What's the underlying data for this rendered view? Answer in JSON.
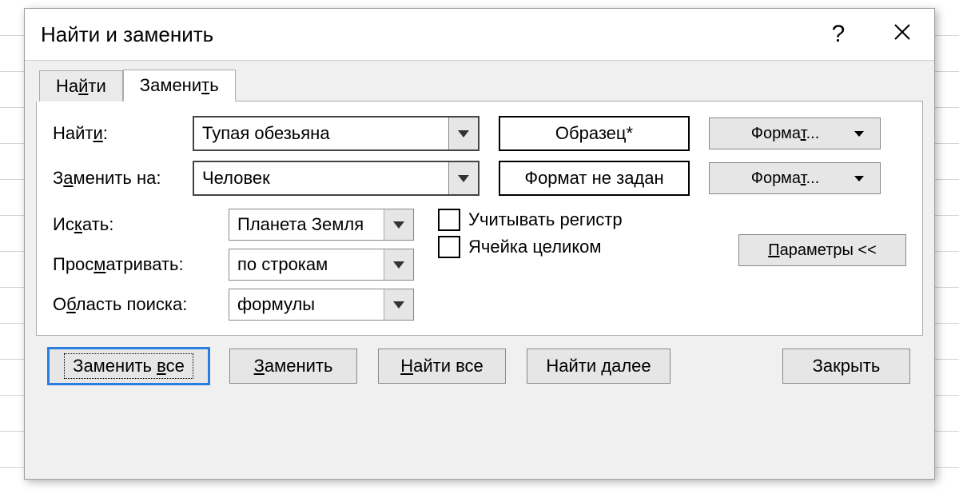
{
  "title": "Найти и заменить",
  "help_symbol": "?",
  "tabs": {
    "find": "Найти",
    "replace": "Заменить"
  },
  "labels": {
    "find_what": "Найти:",
    "replace_with": "Заменить на:",
    "search_in": "Искать:",
    "look_by": "Просматривать:",
    "look_in": "Область поиска:",
    "match_case": "Учитывать регистр",
    "whole_cell": "Ячейка целиком"
  },
  "values": {
    "find_what": "Тупая обезьяна",
    "replace_with": "Человек",
    "search_in": "Планета Земля",
    "look_by": "по строкам",
    "look_in": "формулы"
  },
  "format": {
    "find_preview": "Образец*",
    "replace_preview": "Формат не задан",
    "button": "Формат..."
  },
  "buttons": {
    "options": "Параметры <<",
    "replace_all": "Заменить все",
    "replace": "Заменить",
    "find_all": "Найти все",
    "find_next": "Найти далее",
    "close": "Закрыть"
  }
}
